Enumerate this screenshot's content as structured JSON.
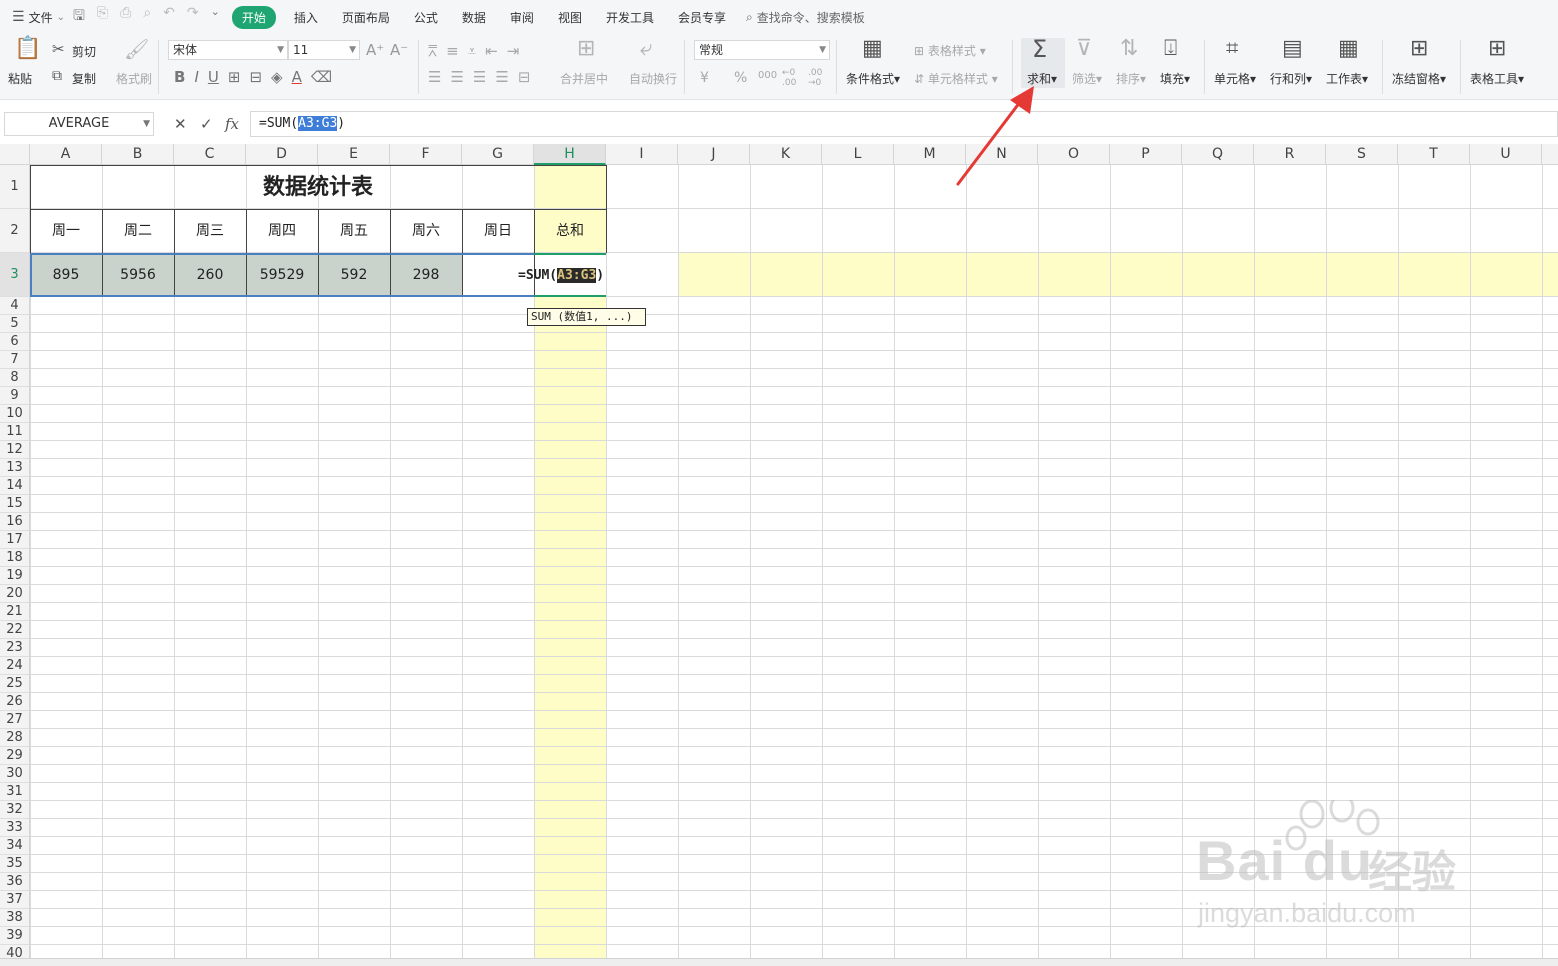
{
  "menubar": {
    "file": "文件",
    "tabs": [
      "开始",
      "插入",
      "页面布局",
      "公式",
      "数据",
      "审阅",
      "视图",
      "开发工具",
      "会员专享"
    ],
    "active_tab": "开始",
    "search_placeholder": "查找命令、搜索模板",
    "colors": {
      "active_tab_bg": "#1fa572"
    }
  },
  "ribbon": {
    "paste": "粘贴",
    "cut": "剪切",
    "copy": "复制",
    "format_painter": "格式刷",
    "font_name": "宋体",
    "font_size": "11",
    "merge_center": "合并居中",
    "wrap_text": "自动换行",
    "number_format": "常规",
    "currency": "¥",
    "percent": "%",
    "thousands": "000",
    "inc_decimal": "←0 .00",
    "dec_decimal": ".00 →0",
    "conditional_format": "条件格式",
    "table_style": "表格样式",
    "cell_style": "单元格样式",
    "sum": "求和",
    "filter": "筛选",
    "sort": "排序",
    "fill": "填充",
    "cells": "单元格",
    "rows_cols": "行和列",
    "worksheet": "工作表",
    "freeze": "冻结窗格",
    "table_tools": "表格工具"
  },
  "formula_bar": {
    "name_box": "AVERAGE",
    "fx": "fx",
    "formula_prefix": "=SUM(",
    "formula_ref": "A3:G3",
    "formula_suffix": ")"
  },
  "columns": [
    "A",
    "B",
    "C",
    "D",
    "E",
    "F",
    "G",
    "H",
    "I",
    "J",
    "K",
    "L",
    "M",
    "N",
    "O",
    "P",
    "Q",
    "R",
    "S",
    "T",
    "U"
  ],
  "active_column": "H",
  "active_row": 3,
  "table": {
    "title": "数据统计表",
    "headers": [
      "周一",
      "周二",
      "周三",
      "周四",
      "周五",
      "周六",
      "周日",
      "总和"
    ],
    "values": [
      "895",
      "5956",
      "260",
      "59529",
      "592",
      "298"
    ],
    "edit_formula_prefix": "=SUM(",
    "edit_formula_ref": "A3:G3",
    "edit_formula_suffix": ")",
    "tooltip": "SUM (数值1, ...)"
  },
  "colors": {
    "highlight_yellow": "#fffdc7",
    "selected_range": "#c9d3cb",
    "accent_green": "#1f9e6a",
    "arrow_red": "#e53935"
  },
  "watermark": {
    "brand": "Bai du",
    "cn": "经验",
    "url": "jingyan.baidu.com"
  }
}
